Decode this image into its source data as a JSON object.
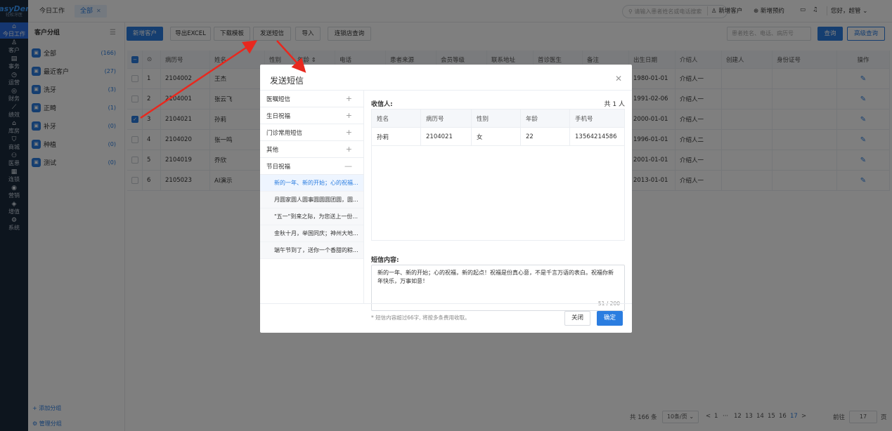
{
  "logo": {
    "name": "EasyDent",
    "sub": "轻松牙医"
  },
  "nav": [
    {
      "label": "今日工作",
      "icon": "⌂",
      "active": true
    },
    {
      "label": "客户",
      "icon": "♙"
    },
    {
      "label": "事务",
      "icon": "▤"
    },
    {
      "label": "运营",
      "icon": "◷"
    },
    {
      "label": "财务",
      "icon": "◎"
    },
    {
      "label": "绩效",
      "icon": "⟋"
    },
    {
      "label": "库房",
      "icon": "⌂"
    },
    {
      "label": "商城",
      "icon": "⛉"
    },
    {
      "label": "医患",
      "icon": "⚇"
    },
    {
      "label": "连锁",
      "icon": "▦"
    },
    {
      "label": "营销",
      "icon": "◉"
    },
    {
      "label": "增值",
      "icon": "◈"
    },
    {
      "label": "系统",
      "icon": "⚙"
    }
  ],
  "topbar": {
    "tab_work": "今日工作",
    "tab_all": "全部",
    "search_placeholder": "请输入患者姓名或电话搜索",
    "new_customer": "新增客户",
    "new_appointment": "新增预约",
    "greeting": "您好，超管"
  },
  "groups": {
    "title": "客户分组",
    "items": [
      {
        "label": "全部",
        "count": "(166)"
      },
      {
        "label": "最近客户",
        "count": "(27)"
      },
      {
        "label": "洗牙",
        "count": "(3)"
      },
      {
        "label": "正畸",
        "count": "(1)"
      },
      {
        "label": "补牙",
        "count": "(0)"
      },
      {
        "label": "种植",
        "count": "(0)"
      },
      {
        "label": "测试",
        "count": "(0)"
      }
    ],
    "add": "+ 添加分组",
    "manage": "⚙ 管理分组"
  },
  "toolbar": {
    "new_customer": "新增客户",
    "export": "导出EXCEL",
    "download": "下载模板",
    "send_sms": "发送短信",
    "import": "导入",
    "chain_query": "连锁店查询",
    "search_placeholder": "患者姓名、电话、病历号",
    "query": "查询",
    "advanced": "高级查询"
  },
  "table": {
    "headers": [
      "",
      "⊙",
      "病历号",
      "姓名",
      "性别",
      "年龄 ⇕",
      "电话",
      "患者来源",
      "会员等级",
      "联系地址",
      "首诊医生",
      "备注",
      "出生日期",
      "介绍人",
      "创建人",
      "身份证号",
      "操作"
    ],
    "rows": [
      {
        "idx": "1",
        "id": "2104002",
        "name": "王杰",
        "birth": "1980-01-01",
        "ref": "介绍人一",
        "checked": false
      },
      {
        "idx": "2",
        "id": "2104001",
        "name": "张云飞",
        "birth": "1991-02-06",
        "ref": "介绍人一",
        "checked": false
      },
      {
        "idx": "3",
        "id": "2104021",
        "name": "孙莉",
        "birth": "2000-01-01",
        "ref": "介绍人一",
        "checked": true
      },
      {
        "idx": "4",
        "id": "2104020",
        "name": "张一鸣",
        "birth": "1996-01-01",
        "ref": "介绍人二",
        "checked": false
      },
      {
        "idx": "5",
        "id": "2104019",
        "name": "乔欣",
        "birth": "2001-01-01",
        "ref": "介绍人一",
        "checked": false
      },
      {
        "idx": "6",
        "id": "2105023",
        "name": "AI演示",
        "birth": "2013-01-01",
        "ref": "介绍人一",
        "checked": false
      }
    ]
  },
  "pager": {
    "total": "共 166 条",
    "per_page": "10条/页",
    "pages": [
      "<",
      "1",
      "···",
      "12",
      "13",
      "14",
      "15",
      "16",
      "17",
      ">"
    ],
    "goto": "前往",
    "current": "17",
    "page_unit": "页"
  },
  "modal": {
    "title": "发送短信",
    "categories": [
      {
        "label": "医嘱短信",
        "sign": "+"
      },
      {
        "label": "生日祝福",
        "sign": "+"
      },
      {
        "label": "门诊常用短信",
        "sign": "+"
      },
      {
        "label": "其他",
        "sign": "+"
      },
      {
        "label": "节日祝福",
        "sign": "—"
      }
    ],
    "templates": [
      "新的一年、新的开始；心的祝福...",
      "月圆家圆人圆事圆圆圆团圆，圆...",
      "\"五一\"到来之际，为您送上一份...",
      "金秋十月，举国同庆；神州大地...",
      "端午节到了，送你一个香甜的粽..."
    ],
    "recipients_label": "收信人:",
    "recipients_total": "共 1 人",
    "recipient_headers": [
      "姓名",
      "病历号",
      "性别",
      "年龄",
      "手机号"
    ],
    "recipient": {
      "name": "孙莉",
      "id": "2104021",
      "gender": "女",
      "age": "22",
      "phone": "13564214586"
    },
    "content_label": "短信内容:",
    "content": "新的一年、新的开始；心的祝福，新的起点！祝福是份真心意，不是千言万语的表白。祝福你新年快乐，万事如意！",
    "char_count": "51 / 200",
    "note": "* 短信内容超过66字, 将按多条费用收取。",
    "close": "关闭",
    "confirm": "确定"
  },
  "colors": {
    "accent": "#2b7de0",
    "nav_bg": "#1b2a3d",
    "annotation_arrow": "#e8281e"
  }
}
